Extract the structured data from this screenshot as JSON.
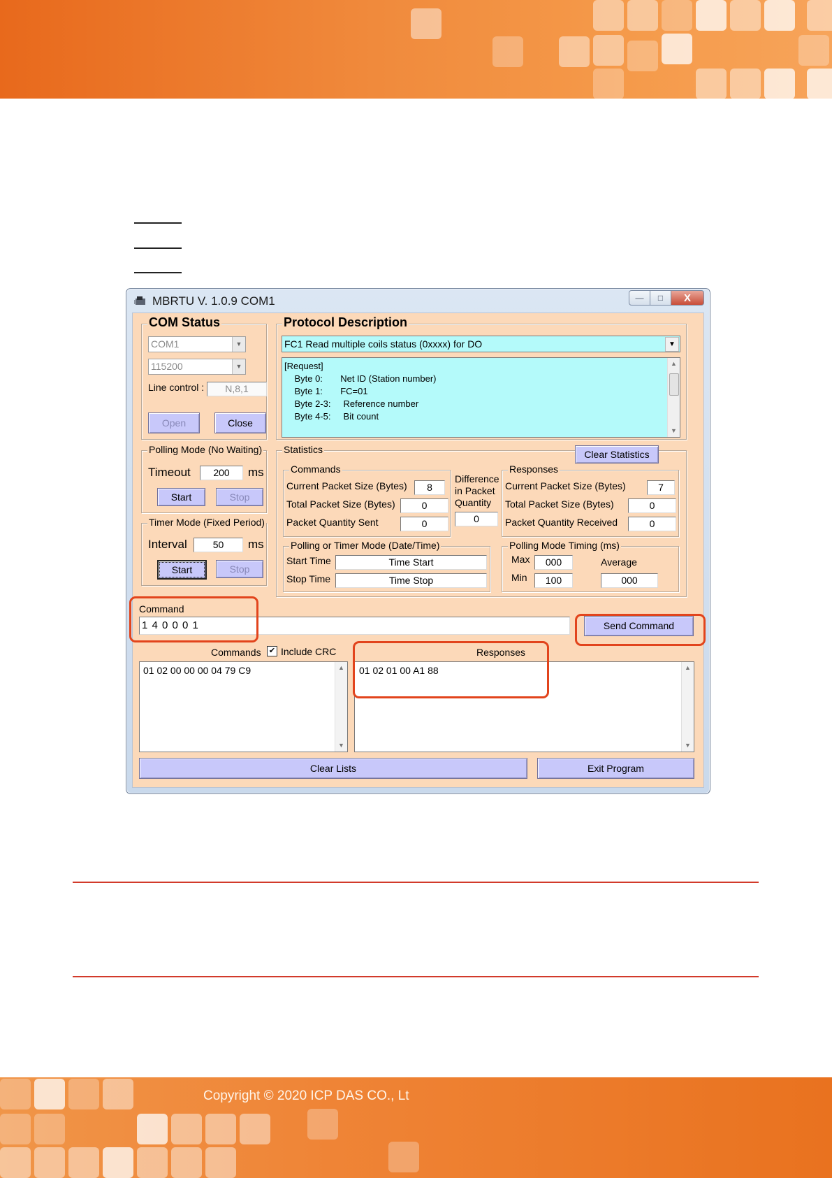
{
  "footer": {
    "copyright": "Copyright © 2020 ICP DAS CO., Lt"
  },
  "window": {
    "title": "MBRTU  V. 1.0.9  COM1",
    "caption_buttons": {
      "minimize": "—",
      "maximize": "□",
      "close": "X"
    }
  },
  "com_status": {
    "legend": "COM Status",
    "port": "COM1",
    "baud": "115200",
    "line_control_label": "Line control :",
    "line_control_value": "N,8,1",
    "open_label": "Open",
    "close_label": "Close"
  },
  "protocol": {
    "legend": "Protocol Description",
    "selected_function": "FC1  Read multiple coils status (0xxxx)  for DO",
    "lines": [
      "[Request]",
      "    Byte 0:       Net ID (Station number)",
      "    Byte 1:       FC=01",
      "    Byte 2-3:     Reference number",
      "    Byte 4-5:     Bit count"
    ]
  },
  "polling_mode": {
    "legend": "Polling Mode (No Waiting)",
    "timeout_label": "Timeout",
    "timeout_value": "200",
    "unit": "ms",
    "start_label": "Start",
    "stop_label": "Stop"
  },
  "timer_mode": {
    "legend": "Timer Mode (Fixed Period)",
    "interval_label": "Interval",
    "interval_value": "50",
    "unit": "ms",
    "start_label": "Start",
    "stop_label": "Stop"
  },
  "statistics": {
    "legend": "Statistics",
    "clear_label": "Clear Statistics",
    "commands_legend": "Commands",
    "responses_legend": "Responses",
    "cmd_current_label": "Current Packet Size (Bytes)",
    "cmd_current_value": "8",
    "cmd_total_label": "Total Packet Size (Bytes)",
    "cmd_total_value": "0",
    "cmd_qty_label": "Packet Quantity Sent",
    "cmd_qty_value": "0",
    "diff_label_1": "Difference",
    "diff_label_2": "in Packet",
    "diff_label_3": "Quantity",
    "diff_value": "0",
    "rsp_current_label": "Current Packet Size (Bytes)",
    "rsp_current_value": "7",
    "rsp_total_label": "Total Packet Size (Bytes)",
    "rsp_total_value": "0",
    "rsp_qty_label": "Packet Quantity Received",
    "rsp_qty_value": "0",
    "datetime_legend": "Polling  or Timer Mode  (Date/Time)",
    "start_time_label": "Start Time",
    "start_time_value": "Time Start",
    "stop_time_label": "Stop Time",
    "stop_time_value": "Time Stop",
    "timing_legend": "Polling Mode Timing (ms)",
    "max_label": "Max",
    "max_value": "000",
    "min_label": "Min",
    "min_value": "100",
    "average_label": "Average",
    "average_value": "000"
  },
  "command": {
    "label": "Command",
    "value": "1 4 0 0 0 1",
    "send_label": "Send Command"
  },
  "lists": {
    "commands_header": "Commands",
    "include_crc_label": "Include CRC",
    "include_crc_checked": true,
    "check_mark": "✔",
    "responses_header": "Responses",
    "commands_items": [
      "01 02 00 00 00 04 79 C9"
    ],
    "responses_items": [
      "01 02 01 00 A1 88"
    ],
    "clear_lists_label": "Clear Lists",
    "exit_label": "Exit Program"
  },
  "colors": {
    "highlight": "#e2441c",
    "panel": "#fcd9b9",
    "button": "#c8c8fa",
    "description_bg": "#b4fafa"
  }
}
